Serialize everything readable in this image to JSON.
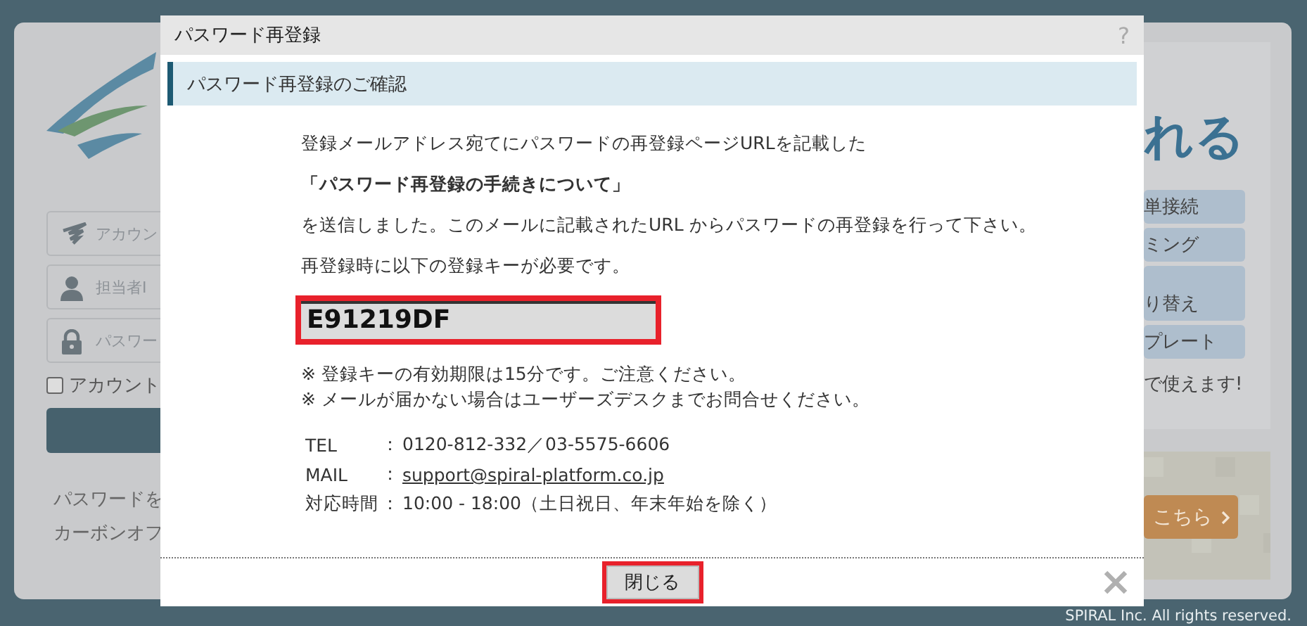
{
  "background": {
    "fields": [
      {
        "kind": "account",
        "placeholder": "アカウン"
      },
      {
        "kind": "user",
        "placeholder": "担当者I"
      },
      {
        "kind": "lock",
        "placeholder": "パスワー"
      }
    ],
    "remember": {
      "label": "アカウント",
      "checked": false
    },
    "links": [
      "パスワードを",
      "カーボンオフ"
    ],
    "headline": "れる",
    "features": [
      "単接続",
      "ミング",
      "り替え",
      "プレート"
    ],
    "tagline": "で使えます!",
    "cta": "こちら",
    "copyright": "SPIRAL Inc. All rights reserved."
  },
  "dialog": {
    "title": "パスワード再登録",
    "help": "?",
    "section_title": "パスワード再登録のご確認",
    "paragraphs": [
      {
        "text": "登録メールアドレス宛てにパスワードの再登録ページURLを記載した",
        "bold": false
      },
      {
        "text": "「パスワード再登録の手続きについて」",
        "bold": true
      },
      {
        "text": "を送信しました。このメールに記載されたURL からパスワードの再登録を行って下さい。",
        "bold": false
      },
      {
        "text": "再登録時に以下の登録キーが必要です。",
        "bold": false
      }
    ],
    "key": "E91219DF",
    "notes": [
      "※ 登録キーの有効期限は15分です。ご注意ください。",
      "※ メールが届かない場合はユーザーズデスクまでお問合せください。"
    ],
    "contacts": [
      {
        "label": "TEL",
        "separator": "：",
        "value": "0120-812-332／03-5575-6606",
        "kind": "text"
      },
      {
        "label": "MAIL",
        "separator": "：",
        "value": "support@spiral-platform.co.jp",
        "kind": "link"
      },
      {
        "label": "対応時間",
        "separator": "：",
        "value": "10:00 - 18:00（土日祝日、年末年始を除く）",
        "kind": "text"
      }
    ],
    "close_button": "閉じる"
  }
}
